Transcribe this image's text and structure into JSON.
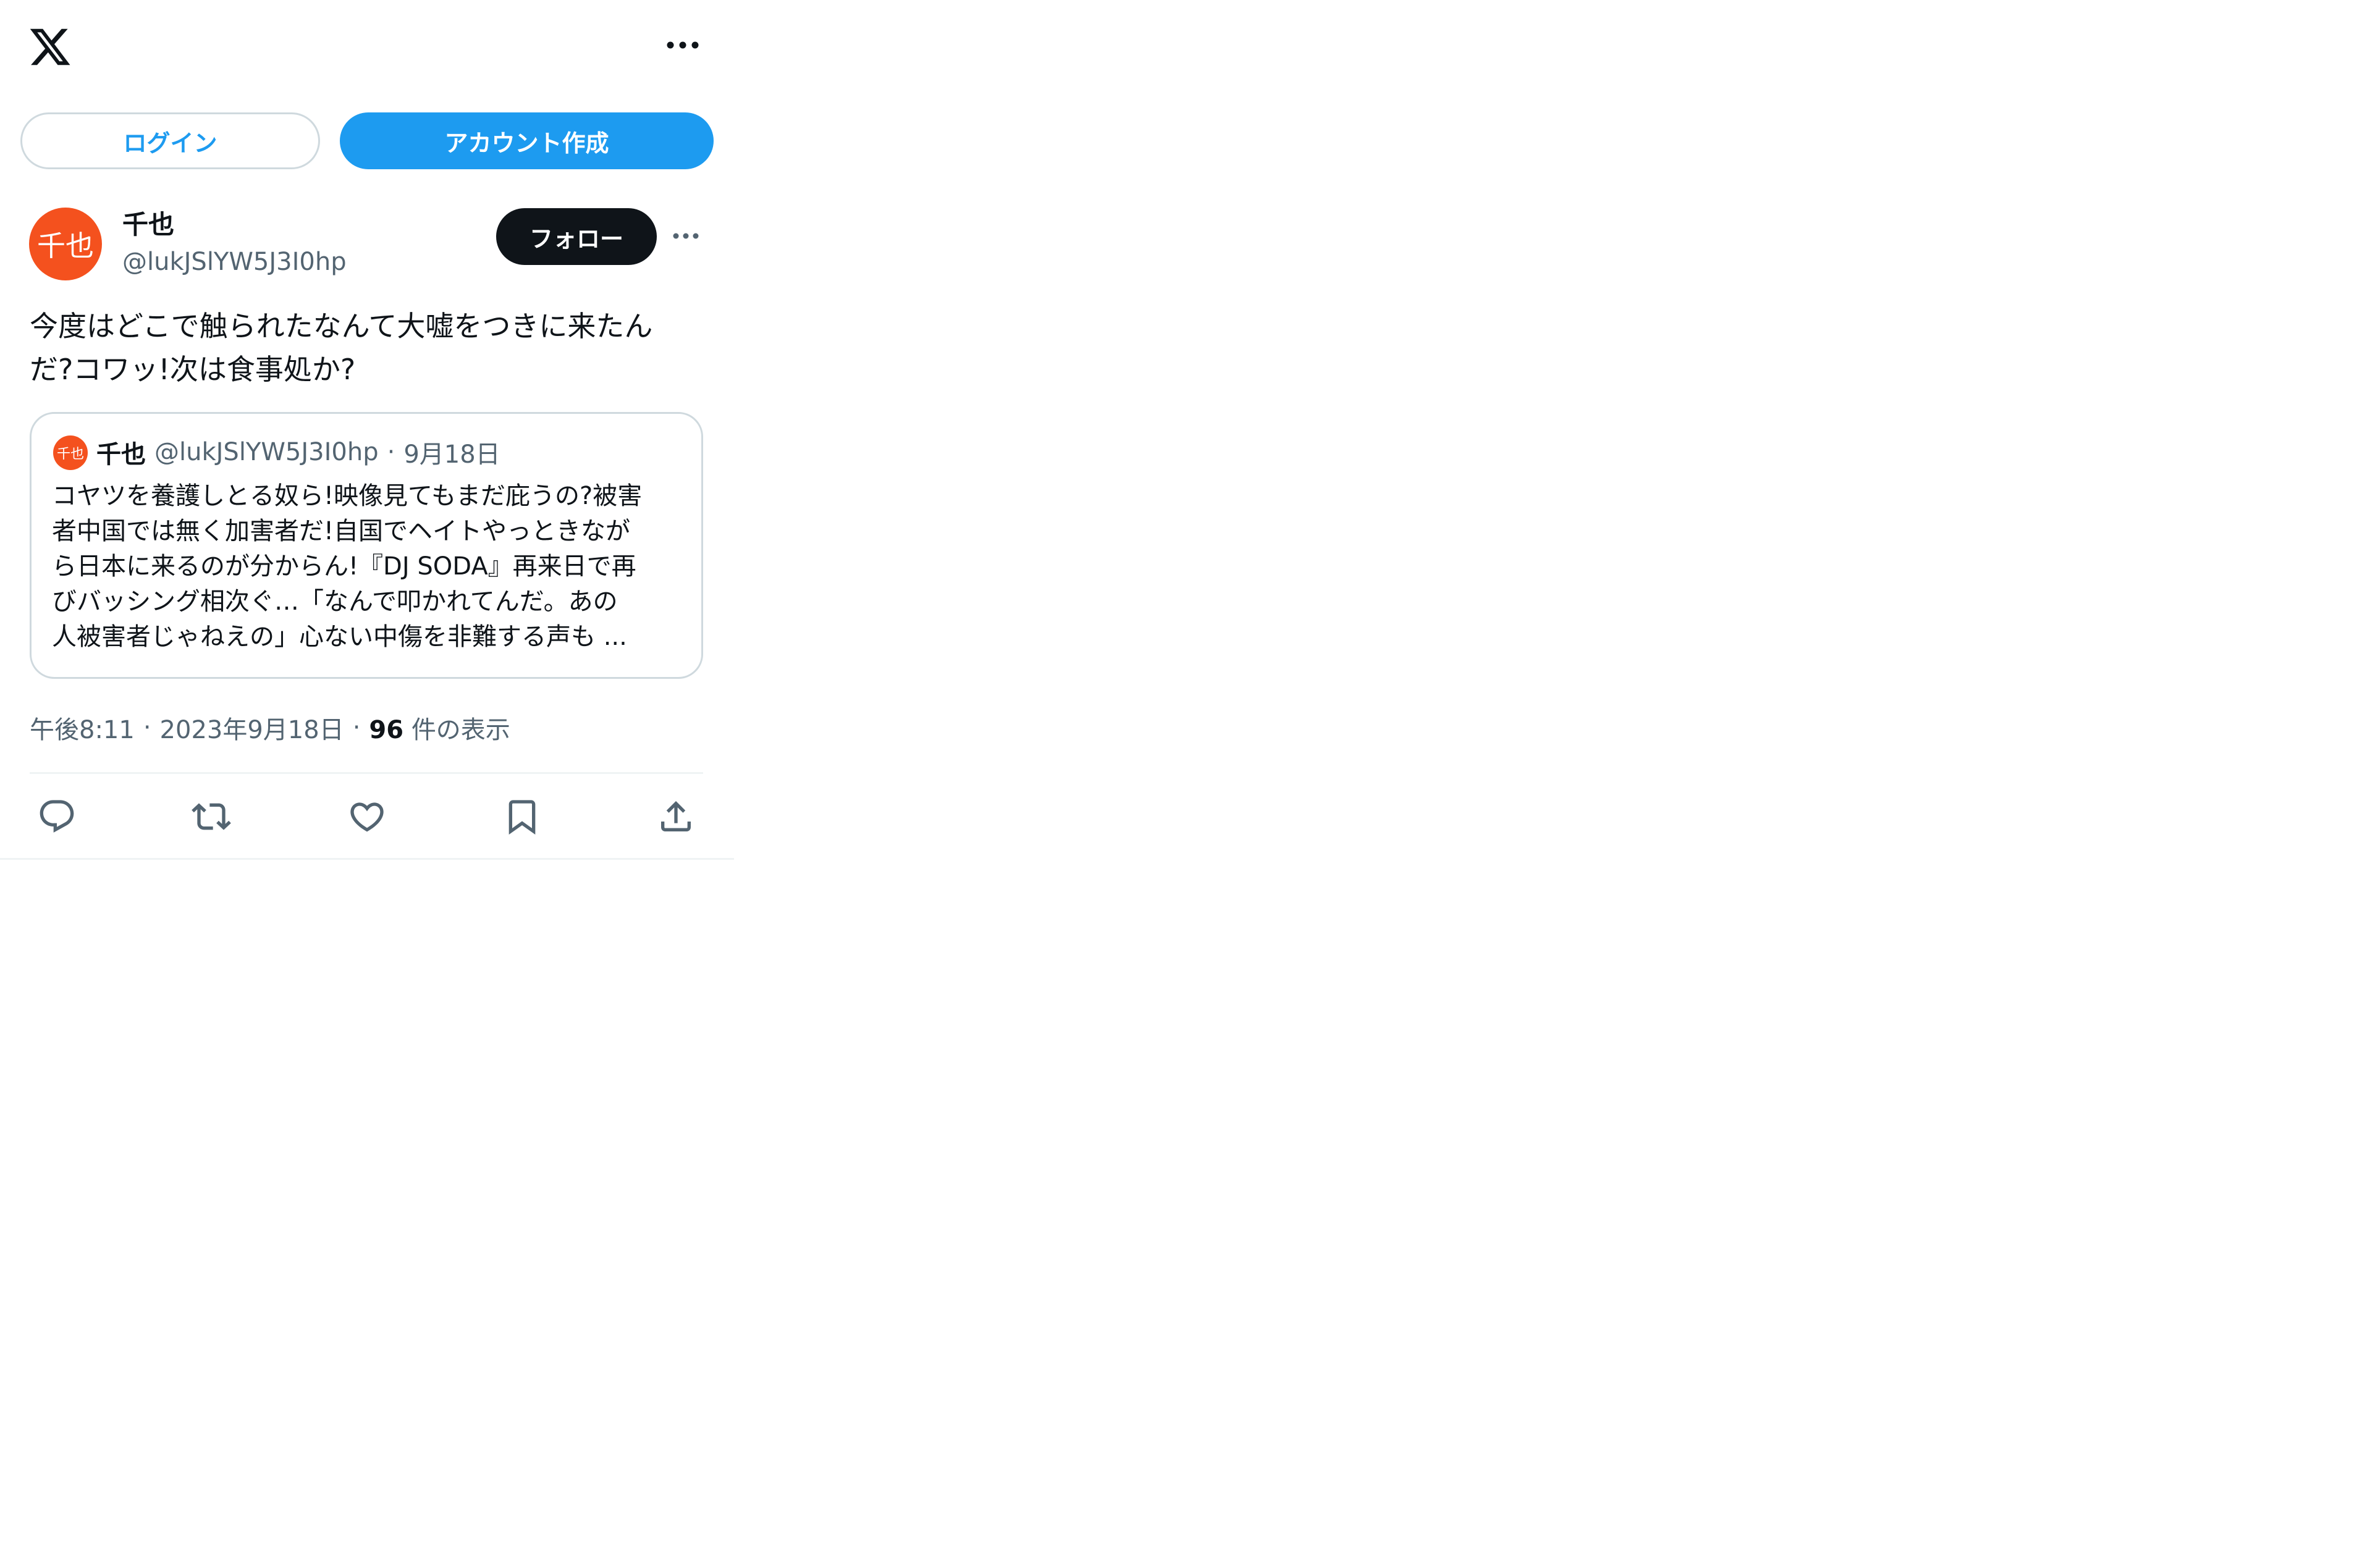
{
  "header": {
    "logo": "x-logo",
    "more_icon": "more-horizontal-icon"
  },
  "auth": {
    "login_label": "ログイン",
    "signup_label": "アカウント作成"
  },
  "tweet": {
    "avatar_text": "千也",
    "author_name": "千也",
    "author_handle": "@lukJSlYW5J3I0hp",
    "follow_label": "フォロー",
    "text": "今度はどこで触られたなんて大嘘をつきに来たん\nだ?コワッ!次は食事処か?",
    "quoted": {
      "avatar_text": "千也",
      "author_name": "千也",
      "author_handle": "@lukJSlYW5J3I0hp",
      "separator": "·",
      "date": "9月18日",
      "text": "コヤツを養護しとる奴ら!映像見てもまだ庇うの?被害\n者中国では無く加害者だ!自国でヘイトやっときなが\nら日本に来るのが分からん!『DJ SODA』再来日で再\nびバッシング相次ぐ…「なんで叩かれてんだ。あの\n人被害者じゃねえの」心ない中傷を非難する声も ..."
    },
    "meta": {
      "time": "午後8:11",
      "separator1": "·",
      "date": "2023年9月18日",
      "separator2": "·",
      "views_count": "96",
      "views_label": "件の表示"
    },
    "actions": [
      "reply-icon",
      "retweet-icon",
      "like-icon",
      "bookmark-icon",
      "share-icon"
    ]
  },
  "colors": {
    "accent": "#1d9bf0",
    "avatar": "#f4511e",
    "text_primary": "#0f1419",
    "text_secondary": "#536471",
    "border": "#cfd9de"
  }
}
